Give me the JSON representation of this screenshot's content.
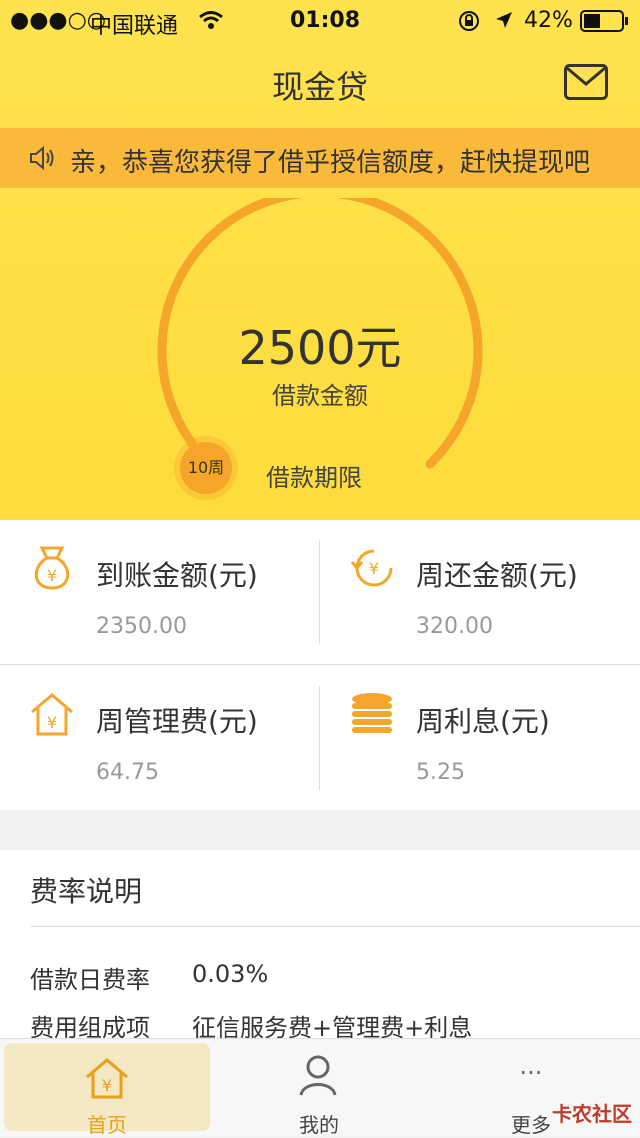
{
  "status_bar": {
    "signal": "●●●○○",
    "carrier": "中国联通",
    "time": "01:08",
    "battery": "42%"
  },
  "header": {
    "title": "现金贷"
  },
  "notice": {
    "text": "亲，恭喜您获得了借乎授信额度，赶快提现吧"
  },
  "loan": {
    "amount": "2500元",
    "amount_label": "借款金额",
    "term_value": "10周",
    "term_label": "借款期限"
  },
  "cards": [
    {
      "title": "到账金额(元)",
      "value": "2350.00",
      "icon": "money-bag-icon"
    },
    {
      "title": "周还金额(元)",
      "value": "320.00",
      "icon": "repay-cycle-icon"
    },
    {
      "title": "周管理费(元)",
      "value": "64.75",
      "icon": "house-yen-icon"
    },
    {
      "title": "周利息(元)",
      "value": "5.25",
      "icon": "coin-stack-icon"
    }
  ],
  "rates": {
    "heading": "费率说明",
    "items": [
      {
        "key": "借款日费率",
        "value": "0.03%"
      },
      {
        "key": "费用组成项",
        "value": "征信服务费+管理费+利息"
      }
    ]
  },
  "tabbar": {
    "home": "首页",
    "mine": "我的",
    "more": "更多",
    "more_icon": "···"
  },
  "watermark": "卡农社区",
  "colors": {
    "accent": "#f4a52a",
    "hero": "#fee24f",
    "notice": "#f9ba3b",
    "active_tab": "#e8a01a"
  }
}
